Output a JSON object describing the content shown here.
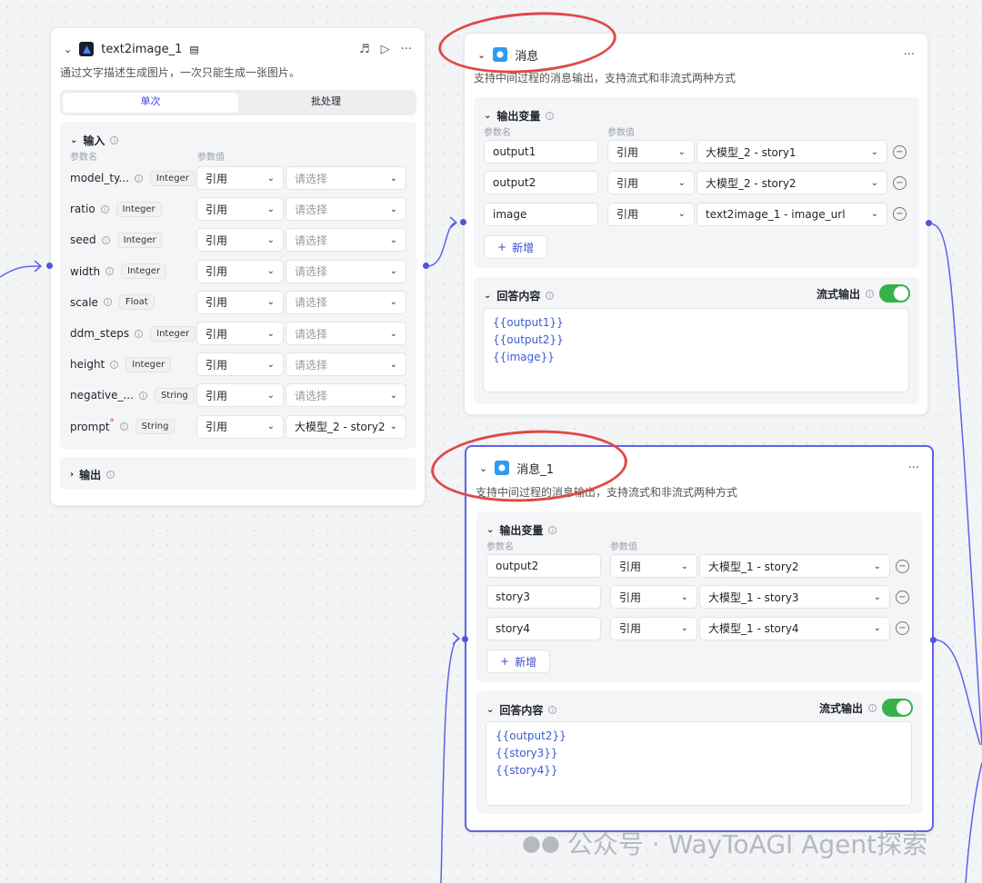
{
  "node1": {
    "title": "text2image_1",
    "desc": "通过文字描述生成图片，一次只能生成一张图片。",
    "tabs": [
      "单次",
      "批处理"
    ],
    "input_section": "输入",
    "col_name": "参数名",
    "col_value": "参数值",
    "params": [
      {
        "name": "model_ty...",
        "type": "Integer",
        "mode": "引用",
        "value": "请选择"
      },
      {
        "name": "ratio",
        "type": "Integer",
        "mode": "引用",
        "value": "请选择"
      },
      {
        "name": "seed",
        "type": "Integer",
        "mode": "引用",
        "value": "请选择"
      },
      {
        "name": "width",
        "type": "Integer",
        "mode": "引用",
        "value": "请选择"
      },
      {
        "name": "scale",
        "type": "Float",
        "mode": "引用",
        "value": "请选择"
      },
      {
        "name": "ddm_steps",
        "type": "Integer",
        "mode": "引用",
        "value": "请选择"
      },
      {
        "name": "height",
        "type": "Integer",
        "mode": "引用",
        "value": "请选择"
      },
      {
        "name": "negative_...",
        "type": "String",
        "mode": "引用",
        "value": "请选择"
      },
      {
        "name": "prompt",
        "type": "String",
        "mode": "引用",
        "value": "大模型_2 - story2"
      }
    ],
    "required_mark": "*",
    "output_section": "输出"
  },
  "node2": {
    "title": "消息",
    "desc": "支持中间过程的消息输出，支持流式和非流式两种方式",
    "out_section": "输出变量",
    "col_name": "参数名",
    "col_value": "参数值",
    "vars": [
      {
        "name": "output1",
        "mode": "引用",
        "value": "大模型_2 - story1"
      },
      {
        "name": "output2",
        "mode": "引用",
        "value": "大模型_2 - story2"
      },
      {
        "name": "image",
        "mode": "引用",
        "value": "text2image_1 - image_url"
      }
    ],
    "add_label": "新增",
    "answer_section": "回答内容",
    "stream_label": "流式输出",
    "answer_lines": [
      "{{output1}}",
      "{{output2}}",
      "{{image}}"
    ]
  },
  "node3": {
    "title": "消息_1",
    "desc": "支持中间过程的消息输出，支持流式和非流式两种方式",
    "out_section": "输出变量",
    "col_name": "参数名",
    "col_value": "参数值",
    "vars": [
      {
        "name": "output2",
        "mode": "引用",
        "value": "大模型_1 - story2"
      },
      {
        "name": "story3",
        "mode": "引用",
        "value": "大模型_1 - story3"
      },
      {
        "name": "story4",
        "mode": "引用",
        "value": "大模型_1 - story4"
      }
    ],
    "add_label": "新增",
    "answer_section": "回答内容",
    "stream_label": "流式输出",
    "answer_lines": [
      "{{output2}}",
      "{{story3}}",
      "{{story4}}"
    ]
  },
  "watermark": "公众号 · WayToAGI Agent探索",
  "colors": {
    "accent": "#5d63e6",
    "toggle_on": "#36b24a",
    "annotation": "#e04848",
    "edge": "#4d55d8"
  }
}
